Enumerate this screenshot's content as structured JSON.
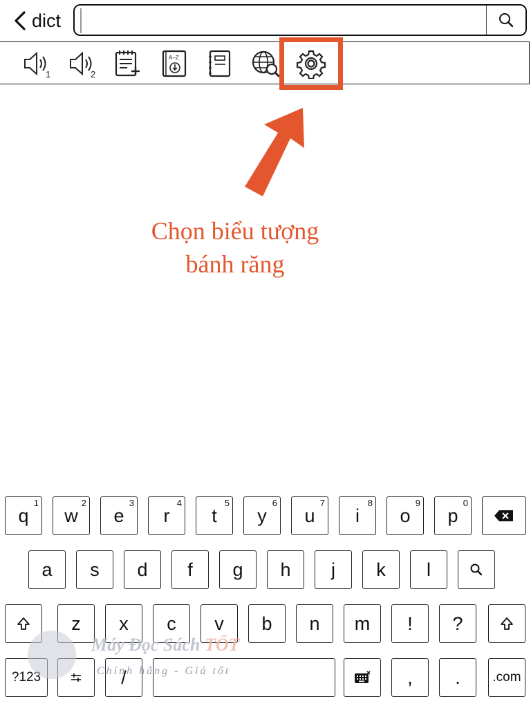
{
  "topbar": {
    "back_label": "dict",
    "search_value": "",
    "search_placeholder": ""
  },
  "toolbar": {
    "tools": [
      {
        "name": "speaker-1-icon",
        "badge": "1"
      },
      {
        "name": "speaker-2-icon",
        "badge": "2"
      },
      {
        "name": "add-note-icon"
      },
      {
        "name": "dictionary-download-icon",
        "badge": "A–Z"
      },
      {
        "name": "notebook-icon"
      },
      {
        "name": "web-search-icon"
      },
      {
        "name": "settings-gear-icon"
      }
    ]
  },
  "annotation": {
    "line1": "Chọn biểu tượng",
    "line2": "bánh răng",
    "color": "#e4572e"
  },
  "keyboard": {
    "row1": [
      {
        "k": "q",
        "s": "1"
      },
      {
        "k": "w",
        "s": "2"
      },
      {
        "k": "e",
        "s": "3"
      },
      {
        "k": "r",
        "s": "4"
      },
      {
        "k": "t",
        "s": "5"
      },
      {
        "k": "y",
        "s": "6"
      },
      {
        "k": "u",
        "s": "7"
      },
      {
        "k": "i",
        "s": "8"
      },
      {
        "k": "o",
        "s": "9"
      },
      {
        "k": "p",
        "s": "0"
      }
    ],
    "row2": [
      "a",
      "s",
      "d",
      "f",
      "g",
      "h",
      "j",
      "k",
      "l"
    ],
    "row3": [
      "z",
      "x",
      "c",
      "v",
      "b",
      "n",
      "m",
      "!",
      "?"
    ],
    "row4": {
      "num": "?123",
      "slash": "/",
      "comma": ",",
      "period": ".",
      "com": ".com"
    }
  },
  "watermark": {
    "title_main": "Máy Đọc Sách ",
    "title_highlight": "TỐT",
    "subtitle": "Chính hãng - Giá tốt"
  }
}
